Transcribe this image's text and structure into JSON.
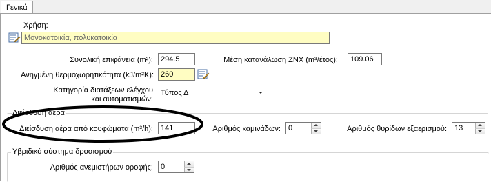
{
  "tabs": [
    {
      "label": "Γενικά"
    }
  ],
  "usage": {
    "label": "Χρήση:",
    "value": "Μονοκατοικία, πολυκατοικία"
  },
  "fields": {
    "total_area_label": "Συνολική επιφάνεια (m²):",
    "total_area_value": "294.5",
    "dhw_label": "Μέση κατανάλωση ΖΝΧ (m³/έτος):",
    "dhw_value": "109.06",
    "heat_capacity_label": "Ανηγμένη θερμοχωρητικότητα (kJ/m²K):",
    "heat_capacity_value": "260",
    "control_label_line1": "Κατηγορία διατάξεων ελέγχου",
    "control_label_line2": "και αυτοματισμών:",
    "control_value": "Τύπος Δ"
  },
  "infiltration": {
    "group_title": "Διείσδυση αέρα",
    "windows_label": "Διείσδυση αέρα από κουφώματα (m³/h):",
    "windows_value": "141",
    "chimneys_label": "Αριθμός καμινάδων:",
    "chimneys_value": "0",
    "vents_label": "Αριθμός θυρίδων εξαερισμού:",
    "vents_value": "13"
  },
  "cooling": {
    "group_title": "Υβριδικό σύστημα δροσισμού",
    "fans_label": "Αριθμός ανεμιστήρων οροφής:",
    "fans_value": "0"
  },
  "colors": {
    "highlight_field": "#fffdc2",
    "annotation_ellipse": "#000000"
  },
  "icons": [
    "edit-list-icon"
  ]
}
